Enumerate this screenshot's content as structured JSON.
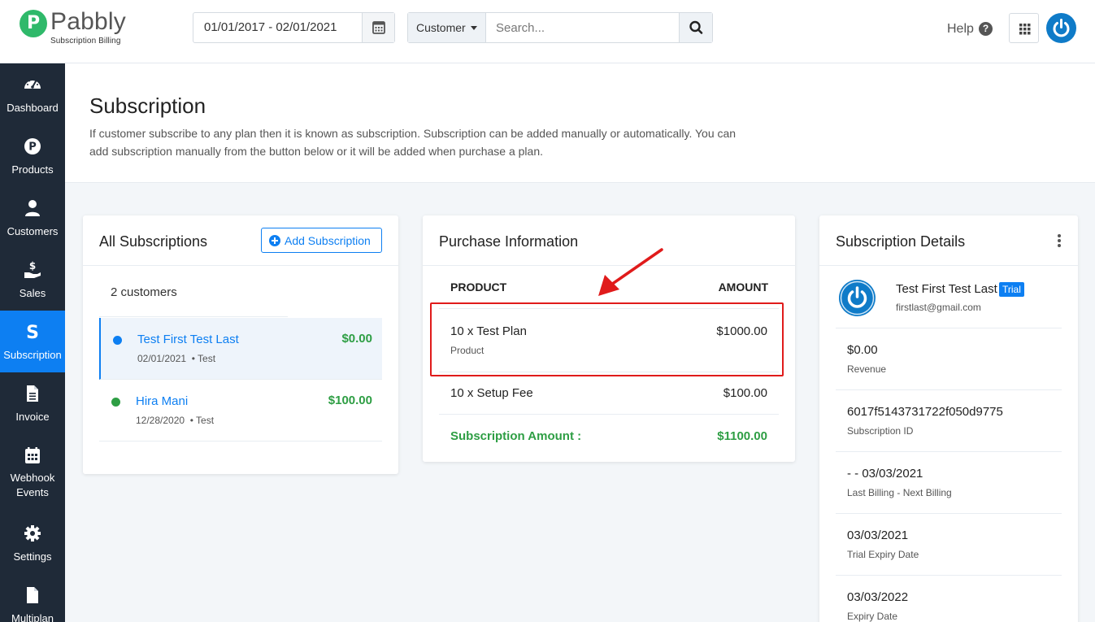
{
  "header": {
    "logo_name": "Pabbly",
    "logo_sub": "Subscription Billing",
    "date_range": "01/01/2017 - 02/01/2021",
    "search_type": "Customer",
    "search_placeholder": "Search...",
    "help_label": "Help"
  },
  "sidebar": {
    "items": [
      {
        "label": "Dashboard"
      },
      {
        "label": "Products"
      },
      {
        "label": "Customers"
      },
      {
        "label": "Sales"
      },
      {
        "label": "Subscription"
      },
      {
        "label": "Invoice"
      },
      {
        "label": "Webhook Events"
      },
      {
        "label": "Settings"
      },
      {
        "label": "Multiplan"
      }
    ]
  },
  "page": {
    "title": "Subscription",
    "description": "If customer subscribe to any plan then it is known as subscription. Subscription can be added manually or automatically. You can add subscription manually from the button below or it will be added when purchase a plan."
  },
  "all_subscriptions": {
    "title": "All Subscriptions",
    "add_label": "Add Subscription",
    "count": "2 customers",
    "rows": [
      {
        "name": "Test First Test Last",
        "date": "02/01/2021",
        "tag": "• Test",
        "amount": "$0.00",
        "status_color": "#0d7ff2"
      },
      {
        "name": "Hira Mani",
        "date": "12/28/2020",
        "tag": "• Test",
        "amount": "$100.00",
        "status_color": "#2e9e44"
      }
    ]
  },
  "purchase": {
    "title": "Purchase Information",
    "col_product": "PRODUCT",
    "col_amount": "AMOUNT",
    "rows": [
      {
        "item": "10 x Test Plan",
        "type": "Product",
        "amount": "$1000.00"
      },
      {
        "item": "10 x Setup Fee",
        "amount": "$100.00"
      }
    ],
    "total_label": "Subscription Amount :",
    "total": "$1100.00"
  },
  "details": {
    "title": "Subscription Details",
    "customer_name": "Test First Test Last",
    "badge": "Trial",
    "email": "firstlast@gmail.com",
    "rows": [
      {
        "value": "$0.00",
        "label": "Revenue"
      },
      {
        "value": "6017f5143731722f050d9775",
        "label": "Subscription ID"
      },
      {
        "value": "- - 03/03/2021",
        "label": "Last Billing - Next Billing"
      },
      {
        "value": "03/03/2021",
        "label": "Trial Expiry Date"
      },
      {
        "value": "03/03/2022",
        "label": "Expiry Date"
      }
    ]
  },
  "colors": {
    "accent": "#0d7ff2",
    "success": "#2e9e44",
    "sidebar": "#1f2a38",
    "highlight": "#e01b1b"
  }
}
